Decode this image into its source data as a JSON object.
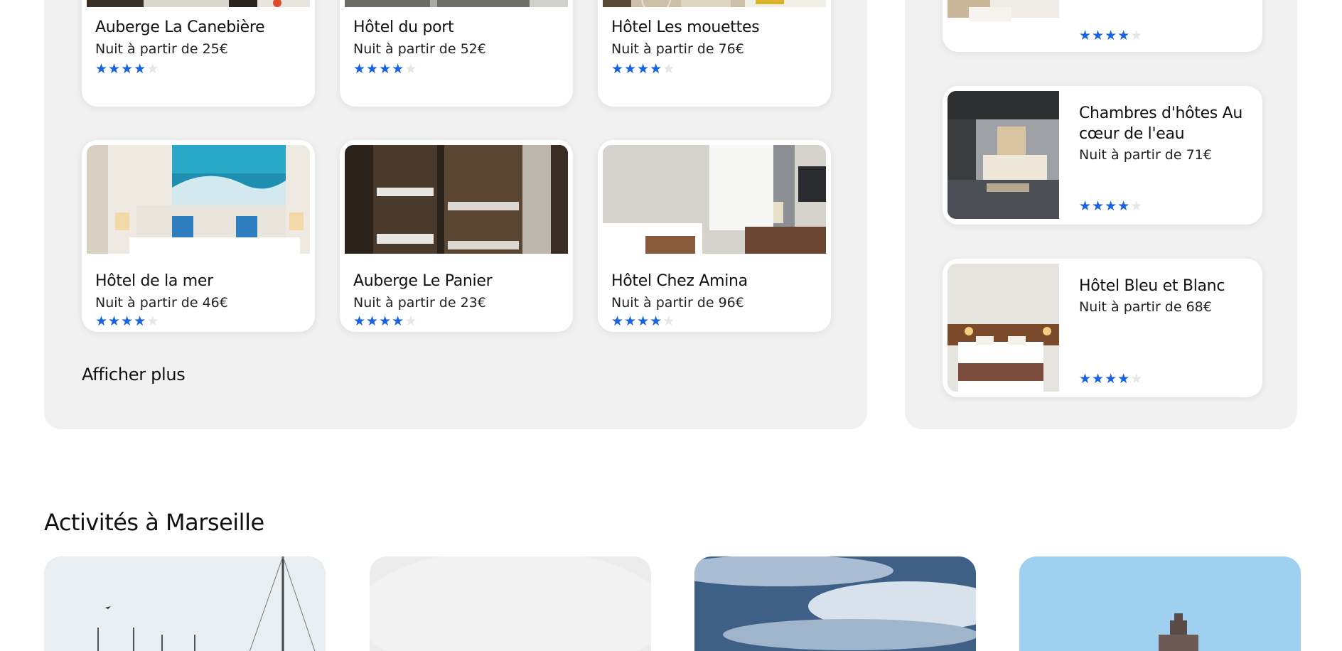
{
  "hotels_grid": [
    {
      "name": "Auberge La Canebière",
      "price": "Nuit à partir de 25€",
      "rating": 4,
      "max": 5
    },
    {
      "name": "Hôtel du port",
      "price": "Nuit à partir de 52€",
      "rating": 4,
      "max": 5
    },
    {
      "name": "Hôtel Les mouettes",
      "price": "Nuit à partir de 76€",
      "rating": 4,
      "max": 5
    },
    {
      "name": "Hôtel de la mer",
      "price": "Nuit à partir de 46€",
      "rating": 4,
      "max": 5
    },
    {
      "name": "Auberge Le Panier",
      "price": "Nuit à partir de 23€",
      "rating": 4,
      "max": 5
    },
    {
      "name": "Hôtel Chez Amina",
      "price": "Nuit à partir de 96€",
      "rating": 4,
      "max": 5
    }
  ],
  "show_more_label": "Afficher plus",
  "side_hotels": [
    {
      "name": "",
      "price": "",
      "rating": 4,
      "max": 5
    },
    {
      "name": "Chambres d'hôtes Au cœur de l'eau",
      "price": "Nuit à partir de 71€",
      "rating": 4,
      "max": 5
    },
    {
      "name": "Hôtel Bleu et Blanc",
      "price": "Nuit à partir de 68€",
      "rating": 4,
      "max": 5
    }
  ],
  "activities": {
    "title": "Activités à Marseille"
  },
  "colors": {
    "star_on": "#1662e0",
    "star_off": "#e6e6e6",
    "panel_bg": "#f1f1f1"
  }
}
